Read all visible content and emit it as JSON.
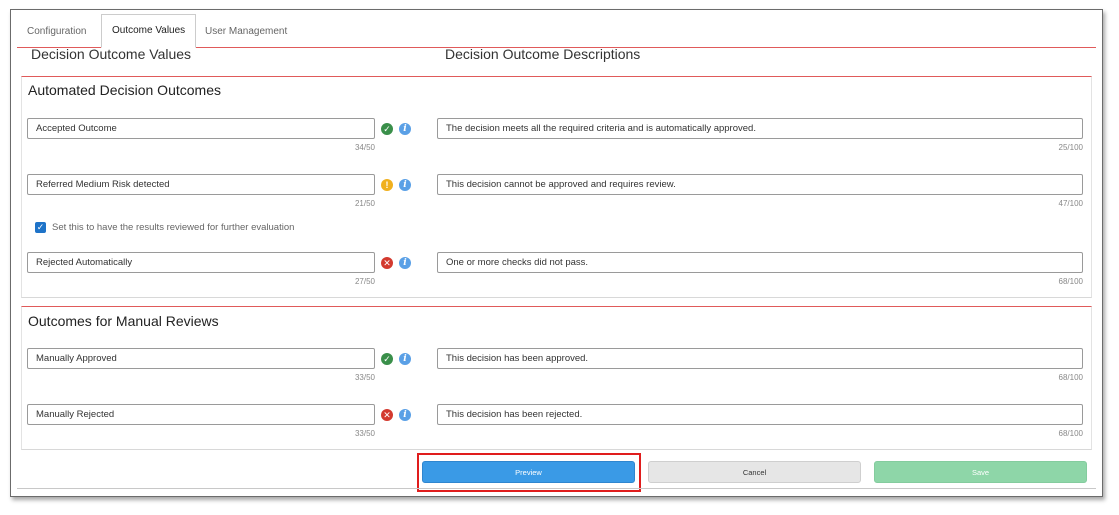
{
  "tabs": [
    {
      "label": "Configuration"
    },
    {
      "label": "Outcome Values"
    },
    {
      "label": "User Management"
    }
  ],
  "columns": {
    "values": "Decision Outcome Values",
    "descriptions": "Decision Outcome Descriptions"
  },
  "automated": {
    "title": "Automated Decision Outcomes",
    "rows": [
      {
        "value": "Accepted Outcome",
        "value_count": "34/50",
        "status": "check-circle-icon",
        "description": "The decision meets all the required criteria and is automatically approved.",
        "desc_count": "25/100"
      },
      {
        "value": "Referred Medium Risk detected",
        "value_count": "21/50",
        "status": "warning-icon",
        "description": "This decision cannot be approved and requires review.",
        "desc_count": "47/100"
      },
      {
        "value": "Rejected Automatically",
        "value_count": "27/50",
        "status": "error-icon",
        "description": "One or more checks did not pass.",
        "desc_count": "68/100"
      }
    ],
    "checkbox_label": "Set this to have the results reviewed for further evaluation"
  },
  "manual": {
    "title": "Outcomes for Manual Reviews",
    "rows": [
      {
        "value": "Manually Approved",
        "value_count": "33/50",
        "status": "check-circle-icon",
        "description": "This decision has been approved.",
        "desc_count": "68/100"
      },
      {
        "value": "Manually Rejected",
        "value_count": "33/50",
        "status": "error-icon",
        "description": "This decision has been rejected.",
        "desc_count": "68/100"
      }
    ]
  },
  "buttons": {
    "preview": "Preview",
    "cancel": "Cancel",
    "save": "Save"
  },
  "colors": {
    "accent_red": "#e05a5a",
    "preview_blue": "#3a9ae6",
    "save_green": "#8ed6a8",
    "highlight_red": "#e01d1d"
  }
}
